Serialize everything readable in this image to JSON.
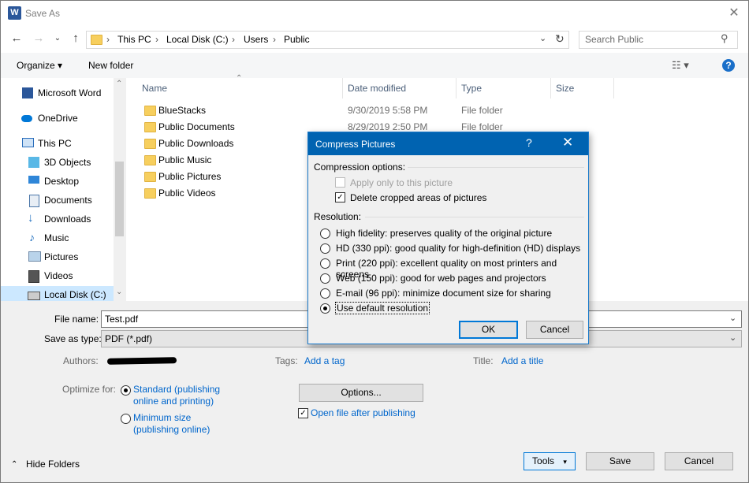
{
  "window": {
    "title": "Save As",
    "app_icon": "W"
  },
  "navigation": {
    "breadcrumbs": [
      "This PC",
      "Local Disk (C:)",
      "Users",
      "Public"
    ],
    "search_placeholder": "Search Public"
  },
  "toolbar": {
    "organize": "Organize ▾",
    "new_folder": "New folder"
  },
  "sidebar": {
    "items": [
      {
        "label": "Microsoft Word",
        "icon": "word-icon"
      },
      {
        "label": "OneDrive",
        "icon": "cloud-icon"
      },
      {
        "label": "This PC",
        "icon": "computer-icon"
      },
      {
        "label": "3D Objects",
        "icon": "cube-icon"
      },
      {
        "label": "Desktop",
        "icon": "desktop-icon"
      },
      {
        "label": "Documents",
        "icon": "document-icon"
      },
      {
        "label": "Downloads",
        "icon": "download-icon"
      },
      {
        "label": "Music",
        "icon": "music-icon"
      },
      {
        "label": "Pictures",
        "icon": "pictures-icon"
      },
      {
        "label": "Videos",
        "icon": "video-icon"
      },
      {
        "label": "Local Disk (C:)",
        "icon": "drive-icon"
      }
    ]
  },
  "files": {
    "columns": [
      "Name",
      "Date modified",
      "Type",
      "Size"
    ],
    "rows": [
      {
        "name": "BlueStacks",
        "date": "9/30/2019 5:58 PM",
        "type": "File folder"
      },
      {
        "name": "Public Documents",
        "date": "8/29/2019 2:50 PM",
        "type": "File folder"
      },
      {
        "name": "Public Downloads",
        "date": "",
        "type": ""
      },
      {
        "name": "Public Music",
        "date": "",
        "type": ""
      },
      {
        "name": "Public Pictures",
        "date": "",
        "type": ""
      },
      {
        "name": "Public Videos",
        "date": "",
        "type": ""
      }
    ]
  },
  "form": {
    "file_name_label": "File name:",
    "file_name_value": "Test.pdf",
    "save_type_label": "Save as type:",
    "save_type_value": "PDF (*.pdf)",
    "authors_label": "Authors:",
    "tags_label": "Tags:",
    "tags_value": "Add a tag",
    "title_label": "Title:",
    "title_value": "Add a title",
    "optimize_label": "Optimize for:",
    "opt_standard_1": "Standard (publishing",
    "opt_standard_2": "online and printing)",
    "opt_minimum_1": "Minimum size",
    "opt_minimum_2": "(publishing online)",
    "options_button": "Options...",
    "open_after": "Open file after publishing"
  },
  "footer": {
    "hide_folders": "Hide Folders",
    "tools": "Tools",
    "save": "Save",
    "cancel": "Cancel"
  },
  "dialog": {
    "title": "Compress Pictures",
    "help": "?",
    "compression_header": "Compression options:",
    "apply_only": "Apply only to this picture",
    "delete_cropped": "Delete cropped areas of pictures",
    "resolution_header": "Resolution:",
    "options": [
      "High fidelity: preserves quality of the original picture",
      "HD (330 ppi): good quality for high-definition (HD) displays",
      "Print (220 ppi): excellent quality on most printers and screens",
      "Web (150 ppi): good for web pages and projectors",
      "E-mail (96 ppi): minimize document size for sharing",
      "Use default resolution"
    ],
    "selected_index": 5,
    "ok": "OK",
    "cancel": "Cancel"
  },
  "colors": {
    "accent": "#0063b1",
    "link": "#0066cc",
    "folder": "#f7cf5e"
  }
}
